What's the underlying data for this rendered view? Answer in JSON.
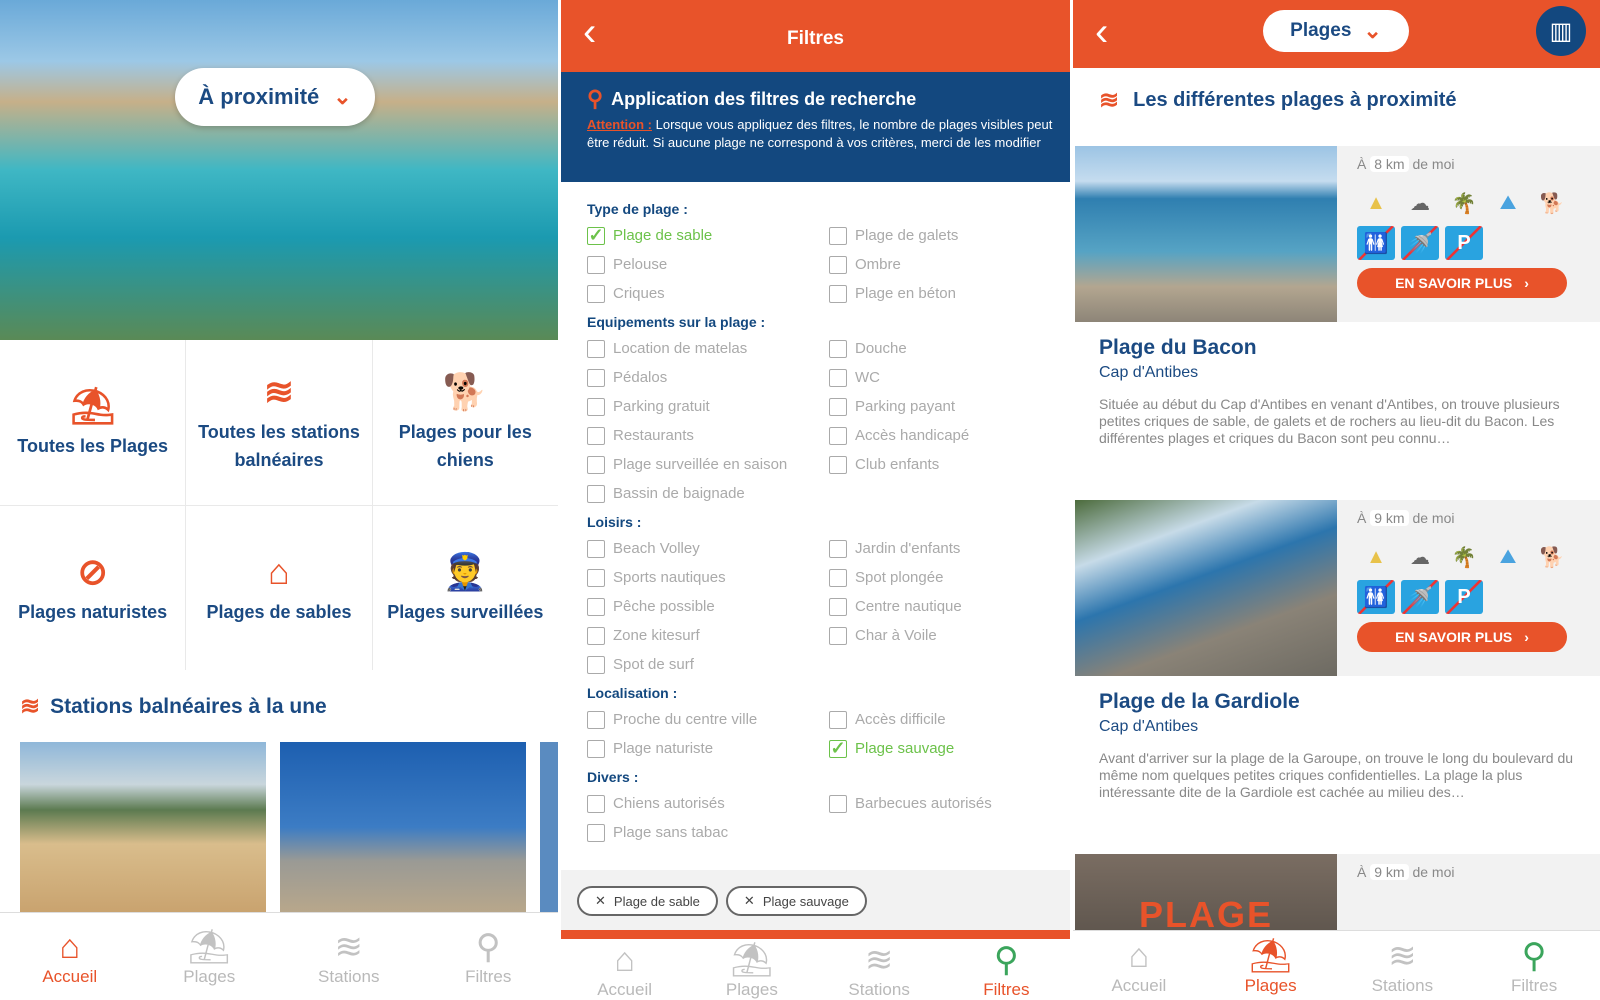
{
  "home": {
    "location_selector": "À proximité",
    "categories": [
      {
        "label": "Toutes les Plages",
        "icon": "⛱"
      },
      {
        "label": "Toutes les stations balnéaires",
        "icon": "≋"
      },
      {
        "label": "Plages pour les chiens",
        "icon": "🐕"
      },
      {
        "label": "Plages naturistes",
        "icon": "⊘"
      },
      {
        "label": "Plages de sables",
        "icon": "⌂"
      },
      {
        "label": "Plages surveillées",
        "icon": "👮"
      }
    ],
    "featured_title": "Stations balnéaires à la une"
  },
  "nav": [
    "Accueil",
    "Plages",
    "Stations",
    "Filtres"
  ],
  "filters": {
    "title": "Filtres",
    "info_title": "Application des filtres de recherche",
    "info_attention": "Attention :",
    "info_text": "Lorsque vous appliquez des filtres, le nombre de plages visibles peut être réduit. Si aucune plage ne correspond à vos critères, merci de les modifier",
    "sections": [
      {
        "label": "Type de plage :",
        "items": [
          {
            "label": "Plage de sable",
            "checked": true
          },
          {
            "label": "Plage de galets",
            "checked": false
          },
          {
            "label": "Pelouse",
            "checked": false
          },
          {
            "label": "Ombre",
            "checked": false
          },
          {
            "label": "Criques",
            "checked": false
          },
          {
            "label": "Plage en béton",
            "checked": false
          }
        ]
      },
      {
        "label": "Equipements sur la plage :",
        "items": [
          {
            "label": "Location de matelas",
            "checked": false
          },
          {
            "label": "Douche",
            "checked": false
          },
          {
            "label": "Pédalos",
            "checked": false
          },
          {
            "label": "WC",
            "checked": false
          },
          {
            "label": "Parking gratuit",
            "checked": false
          },
          {
            "label": "Parking payant",
            "checked": false
          },
          {
            "label": "Restaurants",
            "checked": false
          },
          {
            "label": "Accès handicapé",
            "checked": false
          },
          {
            "label": "Plage surveillée en saison",
            "checked": false
          },
          {
            "label": "Club enfants",
            "checked": false
          },
          {
            "label": "Bassin de baignade",
            "checked": false
          }
        ]
      },
      {
        "label": "Loisirs :",
        "items": [
          {
            "label": "Beach Volley",
            "checked": false
          },
          {
            "label": "Jardin d'enfants",
            "checked": false
          },
          {
            "label": "Sports nautiques",
            "checked": false
          },
          {
            "label": "Spot plongée",
            "checked": false
          },
          {
            "label": "Pêche possible",
            "checked": false
          },
          {
            "label": "Centre nautique",
            "checked": false
          },
          {
            "label": "Zone kitesurf",
            "checked": false
          },
          {
            "label": "Char à Voile",
            "checked": false
          },
          {
            "label": "Spot de surf",
            "checked": false
          }
        ]
      },
      {
        "label": "Localisation :",
        "items": [
          {
            "label": "Proche du centre ville",
            "checked": false
          },
          {
            "label": "Accès difficile",
            "checked": false
          },
          {
            "label": "Plage naturiste",
            "checked": false
          },
          {
            "label": "Plage sauvage",
            "checked": true
          }
        ]
      },
      {
        "label": "Divers :",
        "items": [
          {
            "label": "Chiens autorisés",
            "checked": false
          },
          {
            "label": "Barbecues autorisés",
            "checked": false
          },
          {
            "label": "Plage sans tabac",
            "checked": false
          }
        ]
      }
    ],
    "active_chips": [
      "Plage de sable",
      "Plage sauvage"
    ]
  },
  "beaches": {
    "selector": "Plages",
    "title": "Les différentes plages à proximité",
    "more_label": "EN SAVOIR PLUS",
    "cards": [
      {
        "dist_prefix": "À",
        "distance": "8 km",
        "dist_suffix": "de moi",
        "name": "Plage du Bacon",
        "city": "Cap d'Antibes",
        "description": "Située au début du Cap d'Antibes en venant d'Antibes, on trouve plusieurs petites criques de sable, de galets et de rochers au lieu-dit du Bacon. Les différentes plages et criques du Bacon sont peu connu…"
      },
      {
        "dist_prefix": "À",
        "distance": "9 km",
        "dist_suffix": "de moi",
        "name": "Plage de la Gardiole",
        "city": "Cap d'Antibes",
        "description": "Avant d'arriver sur la plage de la Garoupe, on trouve le long du boulevard du même nom quelques petites criques confidentielles. La plage la plus intéressante dite de la Gardiole est cachée au milieu des…"
      },
      {
        "dist_prefix": "À",
        "distance": "9 km",
        "dist_suffix": "de moi",
        "image_text": "PLAGE"
      }
    ]
  },
  "colors": {
    "orange": "#e8532a",
    "navy": "#13487f",
    "green": "#6cc24a"
  }
}
